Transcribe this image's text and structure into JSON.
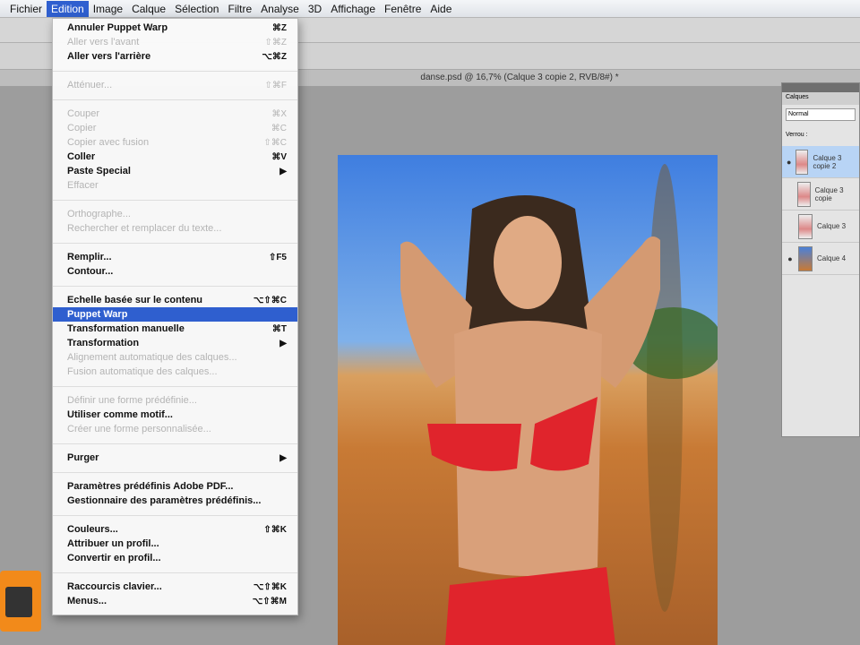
{
  "menubar": [
    "Fichier",
    "Edition",
    "Image",
    "Calque",
    "Sélection",
    "Filtre",
    "Analyse",
    "3D",
    "Affichage",
    "Fenêtre",
    "Aide"
  ],
  "active_menu": 1,
  "document_tab": "danse.psd @ 16,7% (Calque 3 copie 2, RVB/8#) *",
  "edit_menu": [
    {
      "label": "Annuler Puppet Warp",
      "shortcut": "⌘Z"
    },
    {
      "label": "Aller vers l'avant",
      "shortcut": "⇧⌘Z",
      "disabled": true
    },
    {
      "label": "Aller vers l'arrière",
      "shortcut": "⌥⌘Z"
    },
    {
      "sep": true
    },
    {
      "label": "Atténuer...",
      "shortcut": "⇧⌘F",
      "disabled": true
    },
    {
      "sep": true
    },
    {
      "label": "Couper",
      "shortcut": "⌘X",
      "disabled": true
    },
    {
      "label": "Copier",
      "shortcut": "⌘C",
      "disabled": true
    },
    {
      "label": "Copier avec fusion",
      "shortcut": "⇧⌘C",
      "disabled": true
    },
    {
      "label": "Coller",
      "shortcut": "⌘V"
    },
    {
      "label": "Paste Special",
      "shortcut": "▶"
    },
    {
      "label": "Effacer",
      "shortcut": "",
      "disabled": true
    },
    {
      "sep": true
    },
    {
      "label": "Orthographe...",
      "shortcut": "",
      "disabled": true
    },
    {
      "label": "Rechercher et remplacer du texte...",
      "shortcut": "",
      "disabled": true
    },
    {
      "sep": true
    },
    {
      "label": "Remplir...",
      "shortcut": "⇧F5"
    },
    {
      "label": "Contour...",
      "shortcut": ""
    },
    {
      "sep": true
    },
    {
      "label": "Echelle basée sur le contenu",
      "shortcut": "⌥⇧⌘C"
    },
    {
      "label": "Puppet Warp",
      "shortcut": "",
      "highlighted": true
    },
    {
      "label": "Transformation manuelle",
      "shortcut": "⌘T"
    },
    {
      "label": "Transformation",
      "shortcut": "▶"
    },
    {
      "label": "Alignement automatique des calques...",
      "shortcut": "",
      "disabled": true
    },
    {
      "label": "Fusion automatique des calques...",
      "shortcut": "",
      "disabled": true
    },
    {
      "sep": true
    },
    {
      "label": "Définir une forme prédéfinie...",
      "shortcut": "",
      "disabled": true
    },
    {
      "label": "Utiliser comme motif...",
      "shortcut": ""
    },
    {
      "label": "Créer une forme personnalisée...",
      "shortcut": "",
      "disabled": true
    },
    {
      "sep": true
    },
    {
      "label": "Purger",
      "shortcut": "▶"
    },
    {
      "sep": true
    },
    {
      "label": "Paramètres prédéfinis Adobe PDF...",
      "shortcut": ""
    },
    {
      "label": "Gestionnaire des paramètres prédéfinis...",
      "shortcut": ""
    },
    {
      "sep": true
    },
    {
      "label": "Couleurs...",
      "shortcut": "⇧⌘K"
    },
    {
      "label": "Attribuer un profil...",
      "shortcut": ""
    },
    {
      "label": "Convertir en profil...",
      "shortcut": ""
    },
    {
      "sep": true
    },
    {
      "label": "Raccourcis clavier...",
      "shortcut": "⌥⇧⌘K"
    },
    {
      "label": "Menus...",
      "shortcut": "⌥⇧⌘M"
    }
  ],
  "layers_panel": {
    "tab": "Calques",
    "blend_mode": "Normal",
    "lock_label": "Verrou :",
    "layers": [
      {
        "name": "Calque 3 copie 2",
        "visible": true,
        "selected": true
      },
      {
        "name": "Calque 3 copie",
        "visible": false
      },
      {
        "name": "Calque 3",
        "visible": false
      },
      {
        "name": "Calque 4",
        "visible": true
      }
    ]
  },
  "colors": {
    "highlight": "#2f5fcf",
    "app_icon": "#f28a1a"
  }
}
